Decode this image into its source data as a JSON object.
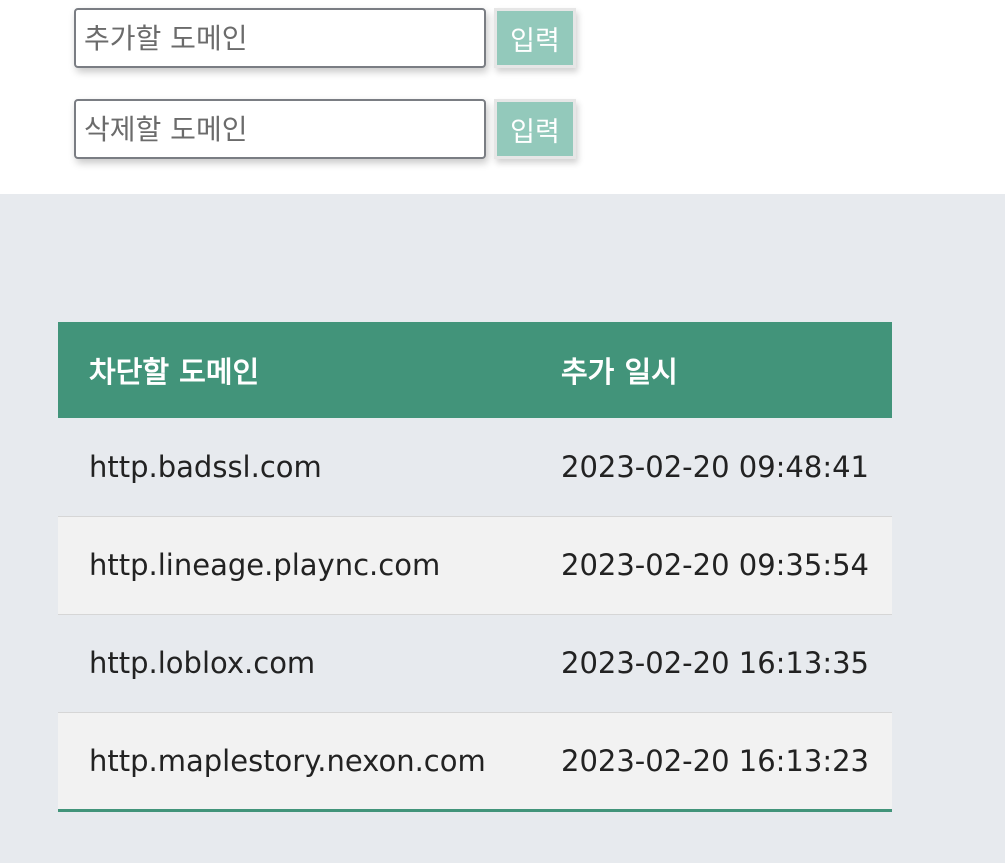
{
  "forms": {
    "add": {
      "placeholder": "추가할 도메인",
      "value": "",
      "button_label": "입력"
    },
    "delete": {
      "placeholder": "삭제할 도메인",
      "value": "",
      "button_label": "입력"
    }
  },
  "table": {
    "headers": {
      "domain": "차단할 도메인",
      "added_at": "추가 일시"
    },
    "rows": [
      {
        "domain": "http.badssl.com",
        "added_at": "2023-02-20 09:48:41"
      },
      {
        "domain": "http.lineage.plaync.com",
        "added_at": "2023-02-20 09:35:54"
      },
      {
        "domain": "http.loblox.com",
        "added_at": "2023-02-20 16:13:35"
      },
      {
        "domain": "http.maplestory.nexon.com",
        "added_at": "2023-02-20 16:13:23"
      }
    ]
  },
  "colors": {
    "accent": "#42947a",
    "button": "#93c9bb",
    "page_background": "#e7eaee",
    "row_alt": "#f2f2f2"
  }
}
